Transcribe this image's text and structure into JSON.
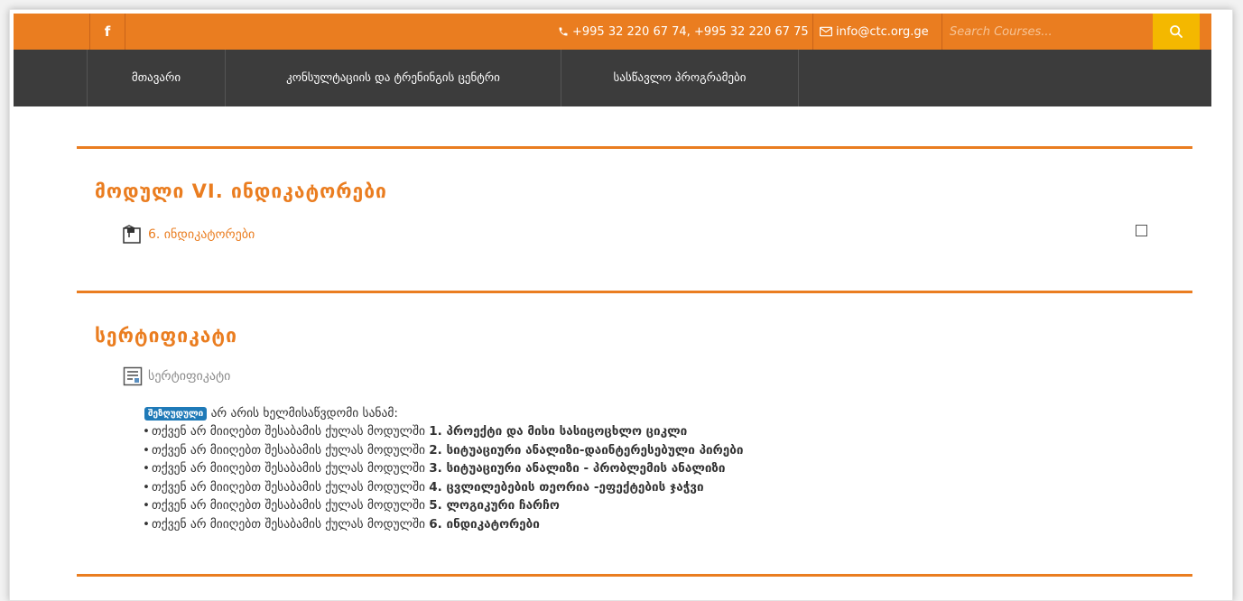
{
  "topbar": {
    "facebook_label": "f",
    "phone": "+995 32 220 67 74, +995 32 220 67 75",
    "email": "info@ctc.org.ge",
    "search_placeholder": "Search Courses...",
    "accent_color": "#ea7d20",
    "search_button_color": "#f4b800"
  },
  "nav": {
    "items": [
      {
        "label": "მთავარი"
      },
      {
        "label": "კონსულტაციის და ტრენინგის ცენტრი"
      },
      {
        "label": "სასწავლო პროგრამები"
      }
    ]
  },
  "sections": [
    {
      "title": "მოდული VI. ინდიკატორები",
      "activity": {
        "label": "6. ინდიკატორები",
        "icon": "file-icon"
      }
    },
    {
      "title": "სერტიფიკატი",
      "activity": {
        "label": "სერტიფიკატი",
        "icon": "certificate-icon"
      }
    }
  ],
  "restriction": {
    "badge": "შეზღუდული",
    "intro": "არ არის ხელმისაწვდომი სანამ:",
    "prefix": "თქვენ არ მიიღებთ შესაბამის ქულას მოდულში",
    "modules": [
      "1. პროექტი და მისი სასიცოცხლო ციკლი",
      "2. სიტუაციური ანალიზი-დაინტერესებული პირები",
      "3. სიტუაციური ანალიზი - პრობლემის ანალიზი",
      "4. ცვლილებების თეორია -ეფექტების ჯაჭვი",
      "5. ლოგიკური ჩარჩო",
      "6. ინდიკატორები"
    ]
  }
}
